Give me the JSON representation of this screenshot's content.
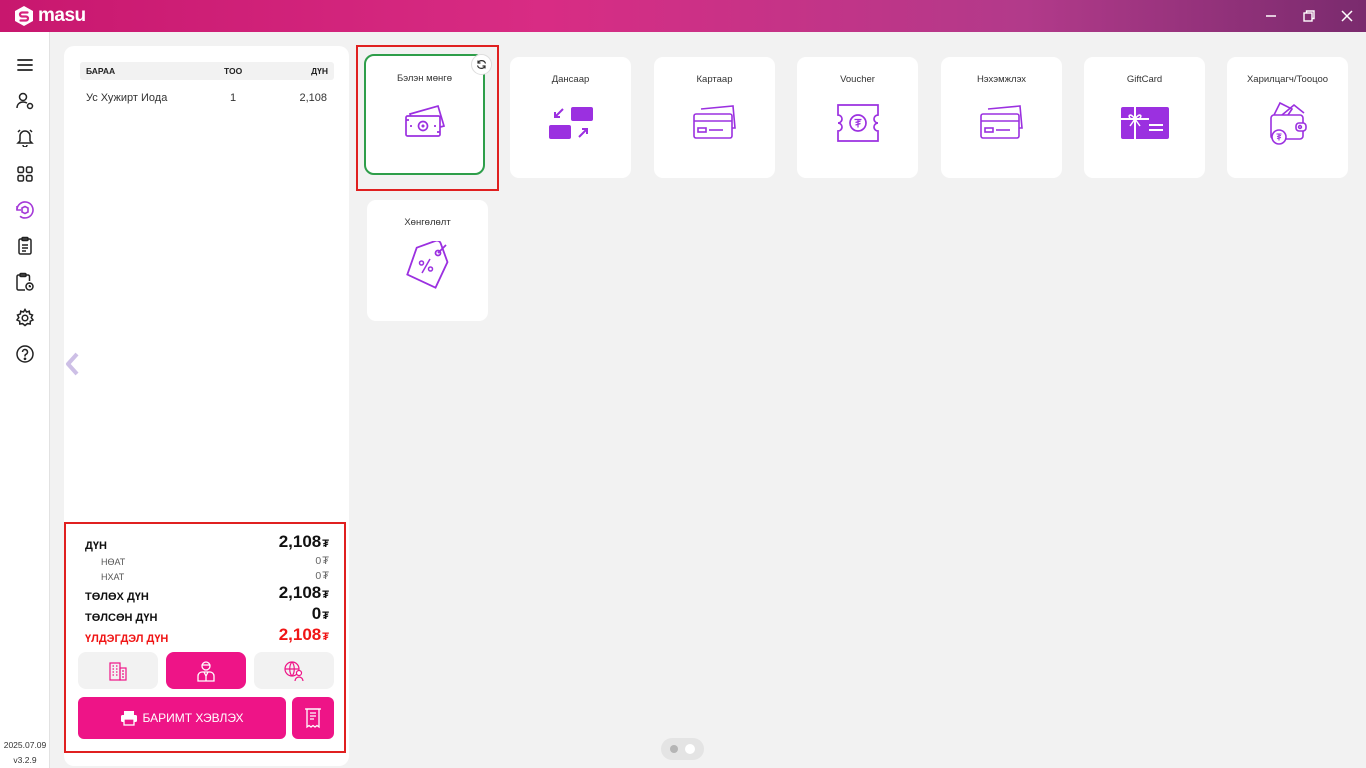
{
  "app": {
    "name": "masu",
    "brand_color": "#ee1487",
    "accent_purple": "#9b30e0"
  },
  "window_controls": [
    "minimize-icon",
    "restore-icon",
    "close-icon"
  ],
  "sidebar": {
    "items": [
      {
        "name": "menu",
        "icon": "hamburger-icon"
      },
      {
        "name": "user-settings",
        "icon": "user-gear-icon"
      },
      {
        "name": "notifications",
        "icon": "bell-icon"
      },
      {
        "name": "apps",
        "icon": "grid-icon"
      },
      {
        "name": "pos",
        "icon": "refresh-box-icon",
        "active": true
      },
      {
        "name": "orders",
        "icon": "clipboard-icon"
      },
      {
        "name": "reports",
        "icon": "clipboard-clock-icon"
      },
      {
        "name": "settings",
        "icon": "gear-icon"
      },
      {
        "name": "help",
        "icon": "help-icon"
      }
    ],
    "date": "2025.07.09",
    "version": "v3.2.9"
  },
  "cart": {
    "headers": {
      "item": "БАРАА",
      "qty": "ТОО",
      "amount": "ДҮН"
    },
    "rows": [
      {
        "item": "Ус Хужирт Иода",
        "qty": "1",
        "amount": "2,108"
      }
    ]
  },
  "summary": {
    "currency": "₮",
    "total_label": "ДҮН",
    "total_value": "2,108",
    "vat_label": "НӨАТ",
    "vat_value": "0",
    "city_tax_label": "НХАТ",
    "city_tax_value": "0",
    "payable_label": "ТӨЛӨХ ДҮН",
    "payable_value": "2,108",
    "paid_label": "ТӨЛСӨН ДҮН",
    "paid_value": "0",
    "remaining_label": "ҮЛДЭГДЭЛ ДҮН",
    "remaining_value": "2,108"
  },
  "customer_modes": [
    {
      "name": "organization",
      "icon": "building-icon",
      "active": false
    },
    {
      "name": "individual",
      "icon": "person-icon",
      "active": true
    },
    {
      "name": "foreign",
      "icon": "globe-person-icon",
      "active": false
    }
  ],
  "actions": {
    "print_label": "БАРИМТ ХЭВЛЭХ"
  },
  "payment_methods": [
    {
      "label": "Бэлэн мөнгө",
      "icon": "cash-icon",
      "selected": true
    },
    {
      "label": "Дансаар",
      "icon": "transfer-icon"
    },
    {
      "label": "Картаар",
      "icon": "card-icon"
    },
    {
      "label": "Voucher",
      "icon": "voucher-icon"
    },
    {
      "label": "Нэхэмжлэх",
      "icon": "invoice-card-icon"
    },
    {
      "label": "GiftCard",
      "icon": "giftcard-icon"
    },
    {
      "label": "Харилцагч/Тооцоо",
      "icon": "wallet-icon"
    },
    {
      "label": "Хөнгөлөлт",
      "icon": "discount-tag-icon"
    }
  ],
  "pager": {
    "pages": 2,
    "current": 2
  }
}
